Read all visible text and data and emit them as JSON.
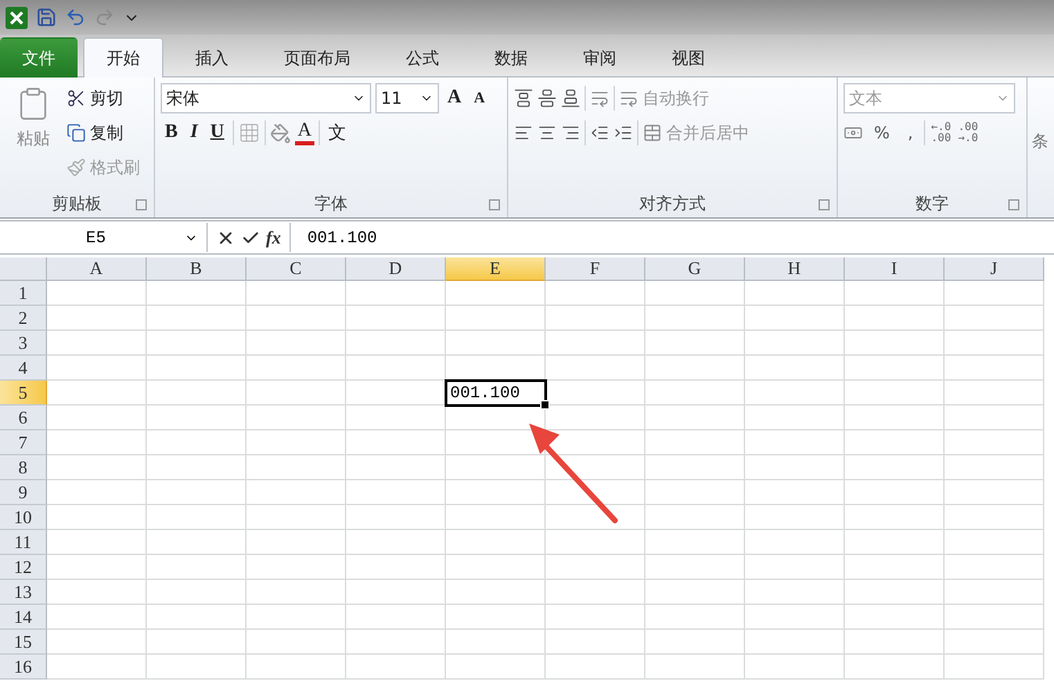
{
  "tabs": [
    {
      "label": "文件",
      "kind": "file",
      "selected": false
    },
    {
      "label": "开始",
      "kind": "tab",
      "selected": true
    },
    {
      "label": "插入",
      "kind": "tab",
      "selected": false
    },
    {
      "label": "页面布局",
      "kind": "tab",
      "selected": false
    },
    {
      "label": "公式",
      "kind": "tab",
      "selected": false
    },
    {
      "label": "数据",
      "kind": "tab",
      "selected": false
    },
    {
      "label": "审阅",
      "kind": "tab",
      "selected": false
    },
    {
      "label": "视图",
      "kind": "tab",
      "selected": false
    }
  ],
  "clipboard": {
    "label": "剪贴板",
    "paste": "粘贴",
    "cut": "剪切",
    "copy": "复制",
    "format_painter": "格式刷"
  },
  "font": {
    "label": "字体",
    "font_name": "宋体",
    "font_size": "11",
    "grow": "A",
    "shrink": "A",
    "bold": "B",
    "italic": "I",
    "underline": "U",
    "font_color": "A",
    "phonetic": "文"
  },
  "alignment": {
    "label": "对齐方式",
    "wrap_text": "自动换行",
    "merge_center": "合并后居中"
  },
  "number": {
    "label": "数字",
    "format": "文本",
    "percent": "%",
    "comma": ",",
    "decimals": [
      {
        "top": "←.0",
        "bottom": ".00"
      },
      {
        "top": ".00",
        "bottom": "→.0"
      }
    ]
  },
  "styles_partial": "条",
  "formula_bar": {
    "name_box": "E5",
    "fx": "fx",
    "value": "001.100"
  },
  "sheet": {
    "columns": [
      {
        "label": "A",
        "selected": false
      },
      {
        "label": "B",
        "selected": false
      },
      {
        "label": "C",
        "selected": false
      },
      {
        "label": "D",
        "selected": false
      },
      {
        "label": "E",
        "selected": true
      },
      {
        "label": "F",
        "selected": false
      },
      {
        "label": "G",
        "selected": false
      },
      {
        "label": "H",
        "selected": false
      },
      {
        "label": "I",
        "selected": false
      },
      {
        "label": "J",
        "selected": false
      }
    ],
    "rows": [
      {
        "label": "1",
        "selected": false
      },
      {
        "label": "2",
        "selected": false
      },
      {
        "label": "3",
        "selected": false
      },
      {
        "label": "4",
        "selected": false
      },
      {
        "label": "5",
        "selected": true,
        "value": "001.100"
      },
      {
        "label": "6",
        "selected": false
      },
      {
        "label": "7",
        "selected": false
      },
      {
        "label": "8",
        "selected": false
      },
      {
        "label": "9",
        "selected": false
      },
      {
        "label": "10",
        "selected": false
      },
      {
        "label": "11",
        "selected": false
      },
      {
        "label": "12",
        "selected": false
      },
      {
        "label": "13",
        "selected": false
      },
      {
        "label": "14",
        "selected": false
      },
      {
        "label": "15",
        "selected": false
      },
      {
        "label": "16",
        "selected": false
      }
    ]
  }
}
